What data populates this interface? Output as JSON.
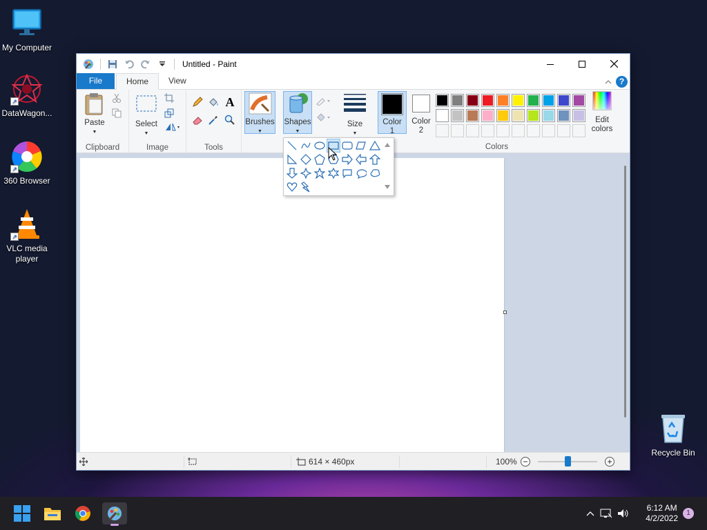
{
  "desktop": {
    "icons": [
      {
        "label": "My Computer"
      },
      {
        "label": "DataWagon..."
      },
      {
        "label": "360 Browser"
      },
      {
        "label": "VLC media player"
      },
      {
        "label": "Recycle Bin"
      }
    ]
  },
  "window": {
    "title": "Untitled - Paint",
    "menu": {
      "file": "File",
      "home": "Home",
      "view": "View",
      "help": "?"
    },
    "ribbon": {
      "clipboard": {
        "label": "Clipboard",
        "paste": "Paste"
      },
      "image": {
        "label": "Image",
        "select": "Select"
      },
      "tools": {
        "label": "Tools",
        "text_glyph": "A"
      },
      "brushes": "Brushes",
      "shapes": "Shapes",
      "size": "Size",
      "color1": "Color\n1",
      "color2": "Color\n2",
      "colors_label": "Colors",
      "edit_colors": "Edit\ncolors"
    },
    "palette_row1": [
      "#000000",
      "#7f7f7f",
      "#880015",
      "#ed1c24",
      "#ff7f27",
      "#fff200",
      "#22b14c",
      "#00a2e8",
      "#3f48cc",
      "#a349a4"
    ],
    "palette_row2": [
      "#ffffff",
      "#c3c3c3",
      "#b97a57",
      "#ffaec9",
      "#ffc90e",
      "#efe4b0",
      "#b5e61d",
      "#99d9ea",
      "#7092be",
      "#c8bfe7"
    ],
    "color1_value": "#000000",
    "color2_value": "#ffffff",
    "status": {
      "dimensions": "614 × 460px",
      "zoom": "100%"
    }
  },
  "taskbar": {
    "time": "6:12 AM",
    "date": "4/2/2022",
    "notifications": "1"
  }
}
